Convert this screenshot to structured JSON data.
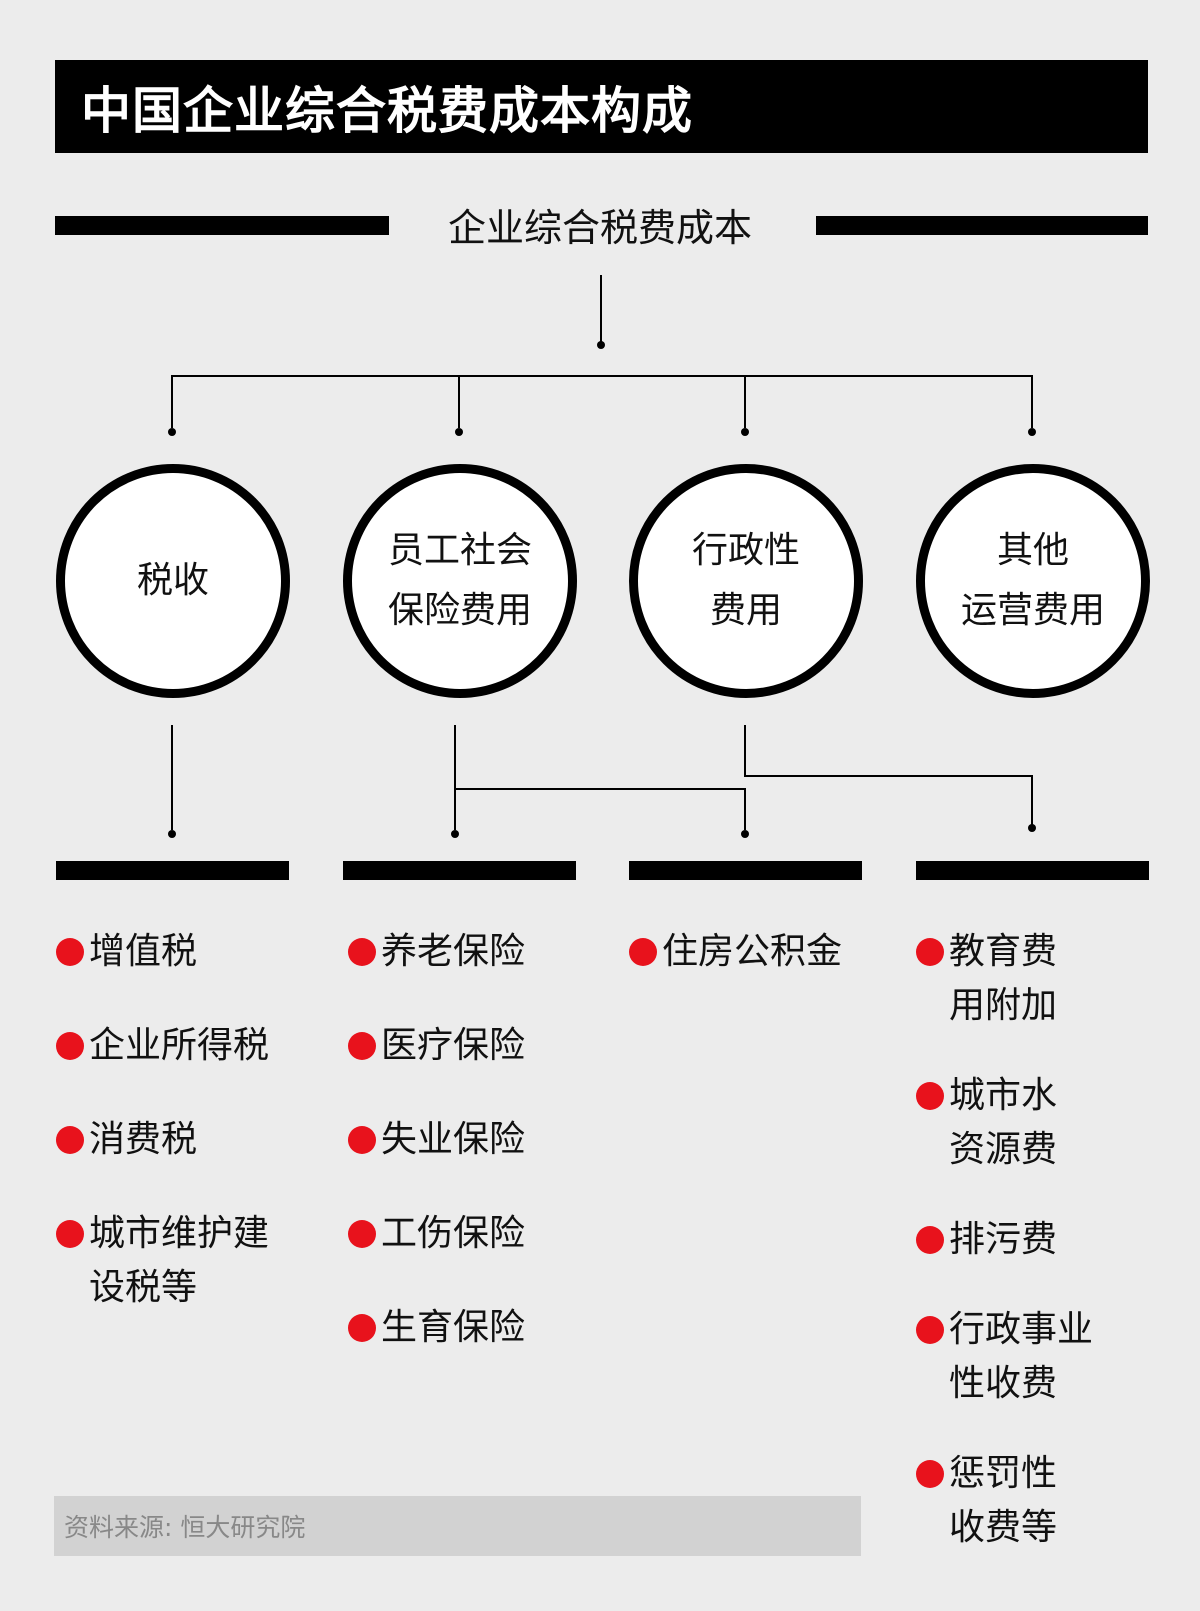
{
  "title": "中国企业综合税费成本构成",
  "root": "企业综合税费成本",
  "categories": [
    {
      "label": "税收",
      "items": [
        "增值税",
        "企业所得税",
        "消费税",
        "城市维护建\n设税等"
      ]
    },
    {
      "label": "员工社会\n保险费用",
      "items": [
        "养老保险",
        "医疗保险",
        "失业保险",
        "工伤保险",
        "生育保险"
      ]
    },
    {
      "label": "行政性\n费用",
      "items": [
        "住房公积金"
      ]
    },
    {
      "label": "其他\n运营费用",
      "items": [
        "教育费\n用附加",
        "城市水\n资源费",
        "排污费",
        "行政事业\n性收费",
        "惩罚性\n收费等"
      ]
    }
  ],
  "source": "资料来源: 恒大研究院",
  "colors": {
    "bullet": "#e8121c",
    "bar": "#000000",
    "background": "#ececec"
  }
}
